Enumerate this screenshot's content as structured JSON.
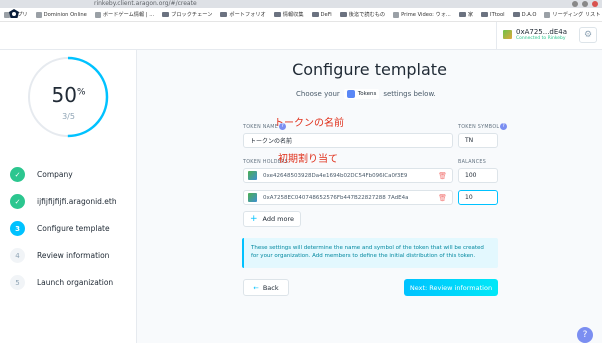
{
  "browser": {
    "url": "rinkeby.client.aragon.org/#/create",
    "bookmarks": [
      "アプリ",
      "Dominion Online",
      "ボードゲーム情報 | ...",
      "ブロックチェーン",
      "ポートフォリオ",
      "情報収集",
      "DeFi",
      "後迄で読むもの",
      "Prime Video: ウォ...",
      "家",
      "ITtool",
      "D.A.O"
    ],
    "reading_list": "リーディング リスト"
  },
  "header": {
    "account_address": "0xA725...dE4a",
    "account_network": "Connected to Rinkeby"
  },
  "sidebar": {
    "progress_percent": "50",
    "progress_symbol": "%",
    "progress_steps": "3/5",
    "steps": [
      {
        "num": "✓",
        "label": "Company"
      },
      {
        "num": "✓",
        "label": "ijfijfijfijfi.aragonid.eth"
      },
      {
        "num": "3",
        "label": "Configure template"
      },
      {
        "num": "4",
        "label": "Review information"
      },
      {
        "num": "5",
        "label": "Launch organization"
      }
    ]
  },
  "main": {
    "title": "Configure template",
    "subtitle_pre": "Choose your",
    "subtitle_chip": "Tokens",
    "subtitle_post": "settings below.",
    "token_name_label": "TOKEN NAME",
    "token_name_value": "トークンの名前",
    "token_symbol_label": "TOKEN SYMBOL",
    "token_symbol_value": "TN",
    "holders_label": "TOKEN HOLDERS",
    "balances_label": "BALANCES",
    "holders": [
      {
        "address": "0xe42648503928Da4e1694b02DC54Fb096ICa0f3E9",
        "balance": "100"
      },
      {
        "address": "0xA7258EC040748652576Fb447B22827288 7AdE4a",
        "balance": "10"
      }
    ],
    "add_more": "Add more",
    "info_text": "These settings will determine the name and symbol of the token that will be created for your organization. Add members to define the initial distribution of this token.",
    "back": "Back",
    "next": "Next: Review information"
  },
  "annotations": {
    "token_name_note": "トークンの名前",
    "allocation_note": "初期割り当て"
  },
  "colors": {
    "accent": "#00c2ff",
    "success": "#2cc68f",
    "annotation": "#e0311c",
    "help": "#7b8ef1"
  }
}
